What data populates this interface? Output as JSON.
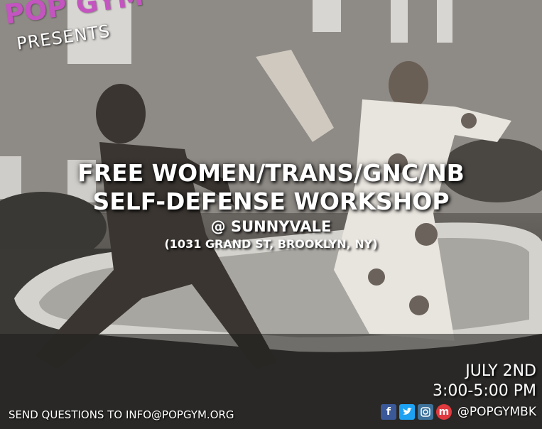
{
  "brand": "POP GYM",
  "presents": "PRESENTS",
  "headline": [
    "FREE WOMEN/TRANS/GNC/NB",
    "SELF-DEFENSE WORKSHOP"
  ],
  "venue": "@ SUNNYVALE",
  "address": "(1031 GRAND ST, BROOKLYN, NY)",
  "date": "JULY 2ND",
  "time": "3:00-5:00 PM",
  "contact": "SEND QUESTIONS TO INFO@POPGYM.ORG",
  "social": {
    "handle": "@POPGYMBK",
    "icons": [
      {
        "name": "facebook-icon",
        "color": "#3b5998"
      },
      {
        "name": "twitter-icon",
        "color": "#1da1f2"
      },
      {
        "name": "instagram-icon",
        "color": "#3f729b"
      },
      {
        "name": "meetup-icon",
        "color": "#e0393e"
      }
    ]
  },
  "colors": {
    "brand": "#c454c0",
    "text": "#ffffff"
  }
}
